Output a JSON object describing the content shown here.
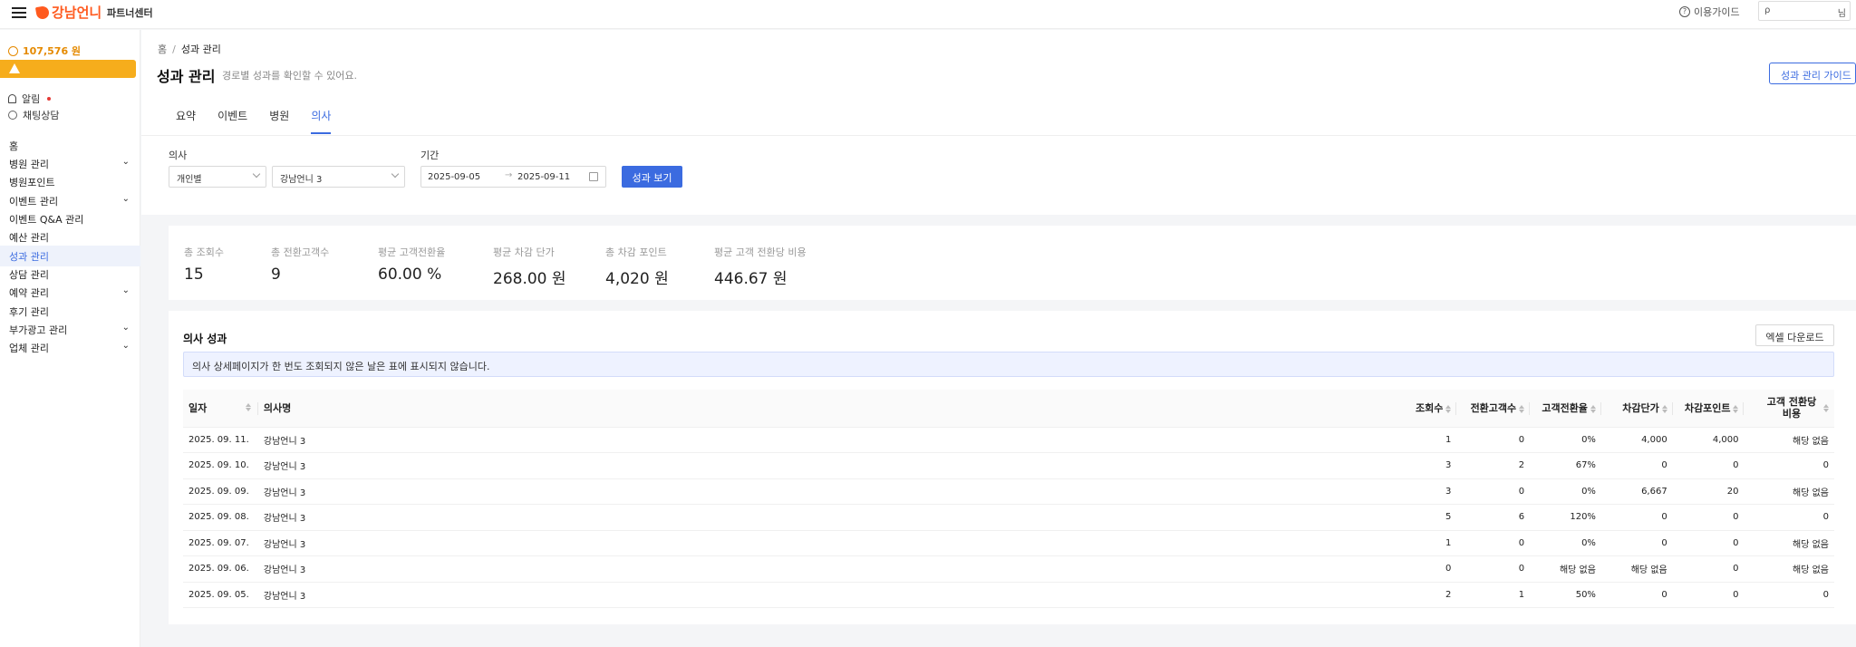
{
  "app": {
    "logo_text": "강남언니",
    "partner_label": "파트너센터",
    "guide_label": "이용가이드",
    "search_placeholder": "",
    "user_suffix": "님"
  },
  "sidebar": {
    "points": "107,576 원",
    "alarm_label": "알림",
    "chat_label": "채팅상담",
    "items": [
      {
        "label": "홈",
        "has_children": false
      },
      {
        "label": "병원 관리",
        "has_children": true
      },
      {
        "label": "병원포인트",
        "has_children": false
      },
      {
        "label": "이벤트 관리",
        "has_children": true
      },
      {
        "label": "이벤트 Q&A 관리",
        "has_children": false
      },
      {
        "label": "예산 관리",
        "has_children": false
      },
      {
        "label": "성과 관리",
        "has_children": false,
        "active": true
      },
      {
        "label": "상담 관리",
        "has_children": false
      },
      {
        "label": "예약 관리",
        "has_children": true
      },
      {
        "label": "후기 관리",
        "has_children": false
      },
      {
        "label": "부가광고 관리",
        "has_children": true
      },
      {
        "label": "업체 관리",
        "has_children": true
      }
    ]
  },
  "header": {
    "breadcrumb": [
      "홈",
      "성과 관리"
    ],
    "title": "성과 관리",
    "subtitle": "경로별 성과를 확인할 수 있어요.",
    "guide_button": "성과 관리 가이드",
    "tabs": [
      {
        "label": "요약",
        "active": false
      },
      {
        "label": "이벤트",
        "active": false
      },
      {
        "label": "병원",
        "active": false
      },
      {
        "label": "의사",
        "active": true
      }
    ]
  },
  "filters": {
    "doctor_label": "의사",
    "type_value": "개인별",
    "doctor_value": "강남언니 3",
    "period_label": "기간",
    "start_date": "2025-09-05",
    "end_date": "2025-09-11",
    "date_separator": "→",
    "view_button": "성과 보기"
  },
  "kpis": [
    {
      "label": "총 조회수",
      "value": "15"
    },
    {
      "label": "총 전환고객수",
      "value": "9"
    },
    {
      "label": "평균 고객전환율",
      "value": "60.00 %"
    },
    {
      "label": "평균 차감 단가",
      "value": "268.00 원"
    },
    {
      "label": "총 차감 포인트",
      "value": "4,020 원"
    },
    {
      "label": "평균 고객 전환당 비용",
      "value": "446.67 원"
    }
  ],
  "table": {
    "title": "의사 성과",
    "excel_button": "엑셀 다운로드",
    "notice": "의사 상세페이지가 한 번도 조회되지 않은 날은 표에 표시되지 않습니다.",
    "columns": [
      "일자",
      "의사명",
      "조회수",
      "전환고객수",
      "고객전환율",
      "차감단가",
      "차감포인트",
      "고객 전환당 비용"
    ],
    "rows": [
      [
        "2025. 09. 11.",
        "강남언니 3",
        "1",
        "0",
        "0%",
        "4,000",
        "4,000",
        "해당 없음"
      ],
      [
        "2025. 09. 10.",
        "강남언니 3",
        "3",
        "2",
        "67%",
        "0",
        "0",
        "0"
      ],
      [
        "2025. 09. 09.",
        "강남언니 3",
        "3",
        "0",
        "0%",
        "6,667",
        "20",
        "해당 없음"
      ],
      [
        "2025. 09. 08.",
        "강남언니 3",
        "5",
        "6",
        "120%",
        "0",
        "0",
        "0"
      ],
      [
        "2025. 09. 07.",
        "강남언니 3",
        "1",
        "0",
        "0%",
        "0",
        "0",
        "해당 없음"
      ],
      [
        "2025. 09. 06.",
        "강남언니 3",
        "0",
        "0",
        "해당 없음",
        "해당 없음",
        "0",
        "해당 없음"
      ],
      [
        "2025. 09. 05.",
        "강남언니 3",
        "2",
        "1",
        "50%",
        "0",
        "0",
        "0"
      ]
    ]
  },
  "colors": {
    "accent": "#3b6be0",
    "brand": "#ff5a1f",
    "warning": "#f6ad1c"
  }
}
